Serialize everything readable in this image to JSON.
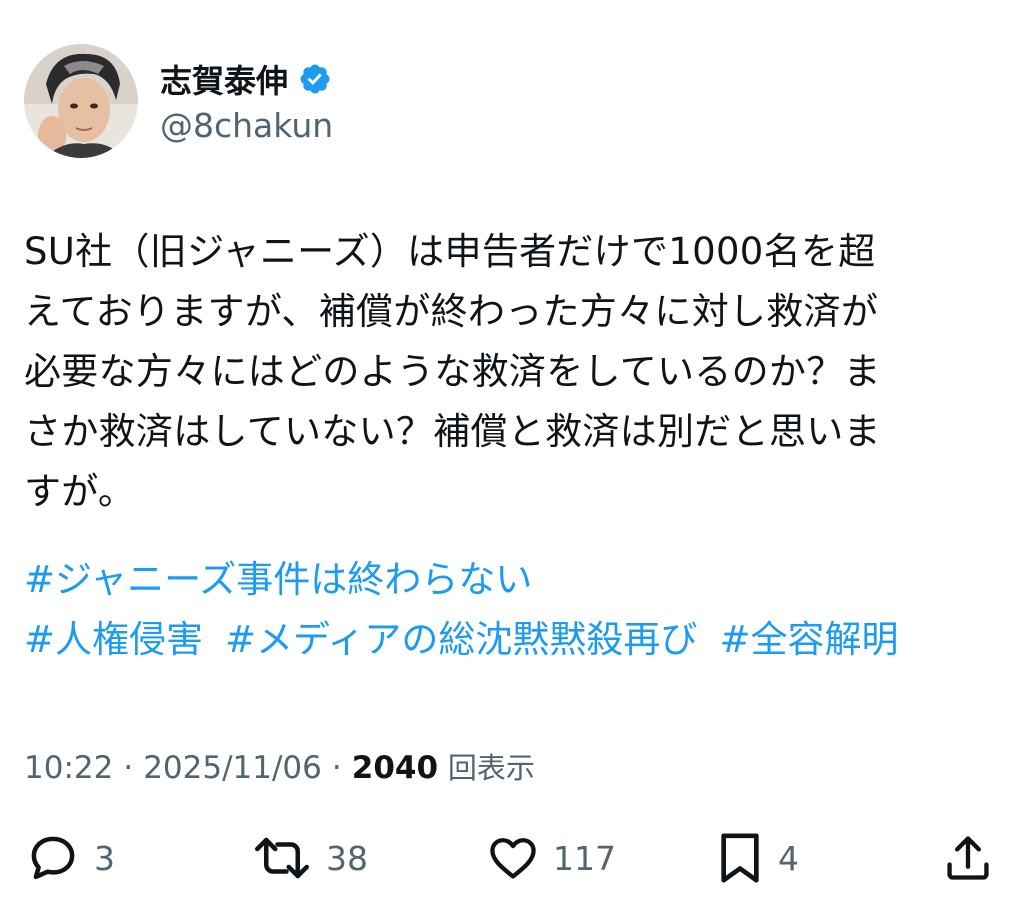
{
  "author": {
    "display_name": "志賀泰伸",
    "handle": "@8chakun",
    "verified": true,
    "verified_color": "#1d9bf0"
  },
  "tweet": {
    "lines": [
      "SU社（旧ジャニーズ）は申告者だけで1000名を超",
      "えておりますが、補償が終わった方々に対し救済が",
      "必要な方々にはどのような救済をしているのか？ま",
      "さか救済はしていない？補償と救済は別だと思いま",
      "すが。"
    ],
    "hashtags": [
      "#ジャニーズ事件は終わらない",
      "#人権侵害",
      "#メディアの総沈黙黙殺再び",
      "#全容解明"
    ],
    "hashtag_color": "#1d9bf0"
  },
  "meta": {
    "time": "10:22",
    "separator": "·",
    "date": "2025/11/06",
    "views_count": "2040",
    "views_label": "回表示"
  },
  "actions": {
    "reply": {
      "icon": "reply-icon",
      "count": "3"
    },
    "retweet": {
      "icon": "retweet-icon",
      "count": "38"
    },
    "like": {
      "icon": "heart-icon",
      "count": "117"
    },
    "bookmark": {
      "icon": "bookmark-icon",
      "count": "4"
    },
    "share": {
      "icon": "share-icon"
    }
  },
  "colors": {
    "text": "#0f1419",
    "secondary": "#536471",
    "accent": "#1d9bf0"
  }
}
